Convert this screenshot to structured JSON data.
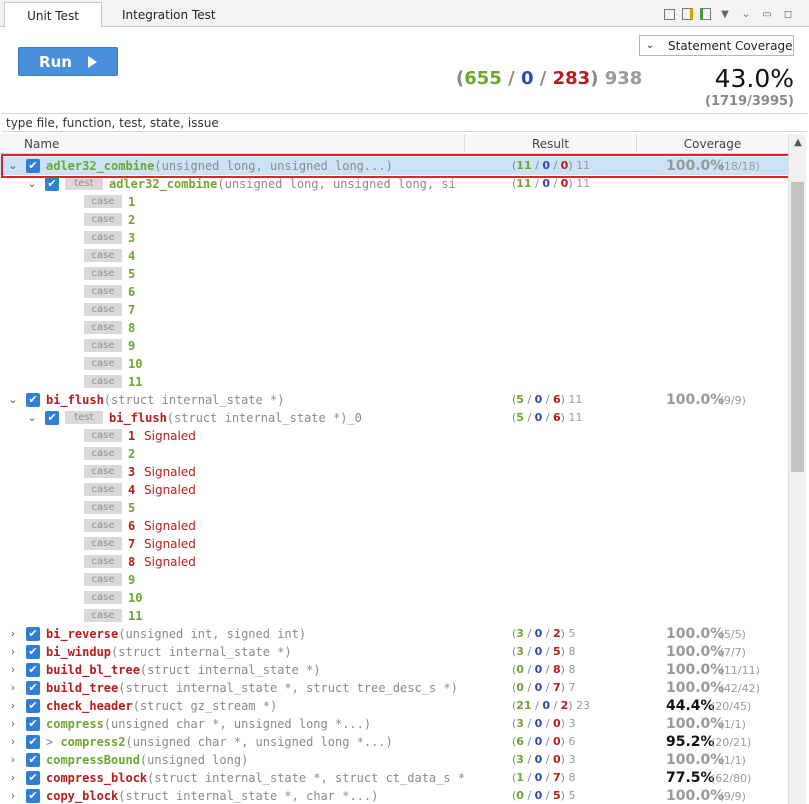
{
  "tabs": [
    {
      "label": "Unit Test",
      "active": true
    },
    {
      "label": "Integration Test",
      "active": false
    }
  ],
  "toolbar_icons": [
    "collapse-all-icon",
    "filter-icon",
    "export-icon",
    "dropdown-icon",
    "view-menu-icon",
    "minimize-icon",
    "maximize-icon"
  ],
  "run_label": "Run",
  "coverage_type": "Statement Coverage",
  "summary": {
    "passed": "655",
    "sep1": "/",
    "blue": "0",
    "sep2": "/",
    "failed": "283",
    "total": "938",
    "open": "(",
    "close": ")"
  },
  "overall_coverage": "43.0%",
  "overall_ratio": "(1719/3995)",
  "filter_placeholder": "type file, function, test, state, issue",
  "columns": {
    "name": "Name",
    "result": "Result",
    "coverage": "Coverage"
  },
  "colors": {
    "pass": "#6aa82e",
    "fail": "#b81c1c",
    "blue": "#2d48b3",
    "accent": "#4a8fdc",
    "selection": "#cce3f7"
  },
  "rows": [
    {
      "kind": "func",
      "expand": "⌄",
      "name": "adler32_combine",
      "args": "(unsigned long, unsigned long...)",
      "color": "green",
      "res": [
        "11",
        "0",
        "0",
        "11"
      ],
      "pct": "100.0%",
      "ratio": "(18/18)",
      "dark": false,
      "selected": true
    },
    {
      "kind": "test",
      "expand": "⌄",
      "name": "adler32_combine",
      "args": "(unsigned long, unsigned long, si",
      "color": "green",
      "res": [
        "11",
        "0",
        "0",
        "11"
      ]
    },
    {
      "kind": "case",
      "num": "1",
      "color": "green",
      "signaled": ""
    },
    {
      "kind": "case",
      "num": "2",
      "color": "green",
      "signaled": ""
    },
    {
      "kind": "case",
      "num": "3",
      "color": "green",
      "signaled": ""
    },
    {
      "kind": "case",
      "num": "4",
      "color": "green",
      "signaled": ""
    },
    {
      "kind": "case",
      "num": "5",
      "color": "green",
      "signaled": ""
    },
    {
      "kind": "case",
      "num": "6",
      "color": "green",
      "signaled": ""
    },
    {
      "kind": "case",
      "num": "7",
      "color": "green",
      "signaled": ""
    },
    {
      "kind": "case",
      "num": "8",
      "color": "green",
      "signaled": ""
    },
    {
      "kind": "case",
      "num": "9",
      "color": "green",
      "signaled": ""
    },
    {
      "kind": "case",
      "num": "10",
      "color": "green",
      "signaled": ""
    },
    {
      "kind": "case",
      "num": "11",
      "color": "green",
      "signaled": ""
    },
    {
      "kind": "func",
      "expand": "⌄",
      "name": "bi_flush",
      "args": "(struct internal_state *)",
      "color": "red",
      "res": [
        "5",
        "0",
        "6",
        "11"
      ],
      "pct": "100.0%",
      "ratio": "(9/9)",
      "dark": false
    },
    {
      "kind": "test",
      "expand": "⌄",
      "name": "bi_flush",
      "args": "(struct internal_state *)_0",
      "color": "red",
      "res": [
        "5",
        "0",
        "6",
        "11"
      ]
    },
    {
      "kind": "case",
      "num": "1",
      "color": "red",
      "signaled": "Signaled"
    },
    {
      "kind": "case",
      "num": "2",
      "color": "green",
      "signaled": ""
    },
    {
      "kind": "case",
      "num": "3",
      "color": "red",
      "signaled": "Signaled"
    },
    {
      "kind": "case",
      "num": "4",
      "color": "red",
      "signaled": "Signaled"
    },
    {
      "kind": "case",
      "num": "5",
      "color": "green",
      "signaled": ""
    },
    {
      "kind": "case",
      "num": "6",
      "color": "red",
      "signaled": "Signaled"
    },
    {
      "kind": "case",
      "num": "7",
      "color": "red",
      "signaled": "Signaled"
    },
    {
      "kind": "case",
      "num": "8",
      "color": "red",
      "signaled": "Signaled"
    },
    {
      "kind": "case",
      "num": "9",
      "color": "green",
      "signaled": ""
    },
    {
      "kind": "case",
      "num": "10",
      "color": "green",
      "signaled": ""
    },
    {
      "kind": "case",
      "num": "11",
      "color": "green",
      "signaled": ""
    },
    {
      "kind": "func",
      "expand": "›",
      "name": "bi_reverse",
      "args": "(unsigned int, signed int)",
      "color": "red",
      "res": [
        "3",
        "0",
        "2",
        "5"
      ],
      "pct": "100.0%",
      "ratio": "(5/5)",
      "dark": false
    },
    {
      "kind": "func",
      "expand": "›",
      "name": "bi_windup",
      "args": "(struct internal_state *)",
      "color": "red",
      "res": [
        "3",
        "0",
        "5",
        "8"
      ],
      "pct": "100.0%",
      "ratio": "(7/7)",
      "dark": false
    },
    {
      "kind": "func",
      "expand": "›",
      "name": "build_bl_tree",
      "args": "(struct internal_state *)",
      "color": "red",
      "res": [
        "0",
        "0",
        "8",
        "8"
      ],
      "pct": "100.0%",
      "ratio": "(11/11)",
      "dark": false
    },
    {
      "kind": "func",
      "expand": "›",
      "name": "build_tree",
      "args": "(struct internal_state *, struct tree_desc_s *)",
      "color": "red",
      "res": [
        "0",
        "0",
        "7",
        "7"
      ],
      "pct": "100.0%",
      "ratio": "(42/42)",
      "dark": false
    },
    {
      "kind": "func",
      "expand": "›",
      "name": "check_header",
      "args": "(struct gz_stream *)",
      "color": "red",
      "res": [
        "21",
        "0",
        "2",
        "23"
      ],
      "pct": "44.4%",
      "ratio": "(20/45)",
      "dark": true
    },
    {
      "kind": "func",
      "expand": "›",
      "name": "compress",
      "args": "(unsigned char *, unsigned long *...)",
      "color": "green",
      "res": [
        "3",
        "0",
        "0",
        "3"
      ],
      "pct": "100.0%",
      "ratio": "(1/1)",
      "dark": false
    },
    {
      "kind": "func",
      "expand": "›",
      "name": "compress2",
      "pre": "> ",
      "args": "(unsigned char *, unsigned long *...)",
      "color": "green",
      "res": [
        "6",
        "0",
        "0",
        "6"
      ],
      "pct": "95.2%",
      "ratio": "(20/21)",
      "dark": true
    },
    {
      "kind": "func",
      "expand": "›",
      "name": "compressBound",
      "args": "(unsigned long)",
      "color": "green",
      "res": [
        "3",
        "0",
        "0",
        "3"
      ],
      "pct": "100.0%",
      "ratio": "(1/1)",
      "dark": false
    },
    {
      "kind": "func",
      "expand": "›",
      "name": "compress_block",
      "args": "(struct internal_state *, struct ct_data_s *",
      "color": "red",
      "res": [
        "1",
        "0",
        "7",
        "8"
      ],
      "pct": "77.5%",
      "ratio": "(62/80)",
      "dark": true
    },
    {
      "kind": "func",
      "expand": "›",
      "name": "copy_block",
      "args": "(struct internal_state *, char *...)",
      "color": "red",
      "res": [
        "0",
        "0",
        "5",
        "5"
      ],
      "pct": "100.0%",
      "ratio": "(9/9)",
      "dark": false
    }
  ]
}
